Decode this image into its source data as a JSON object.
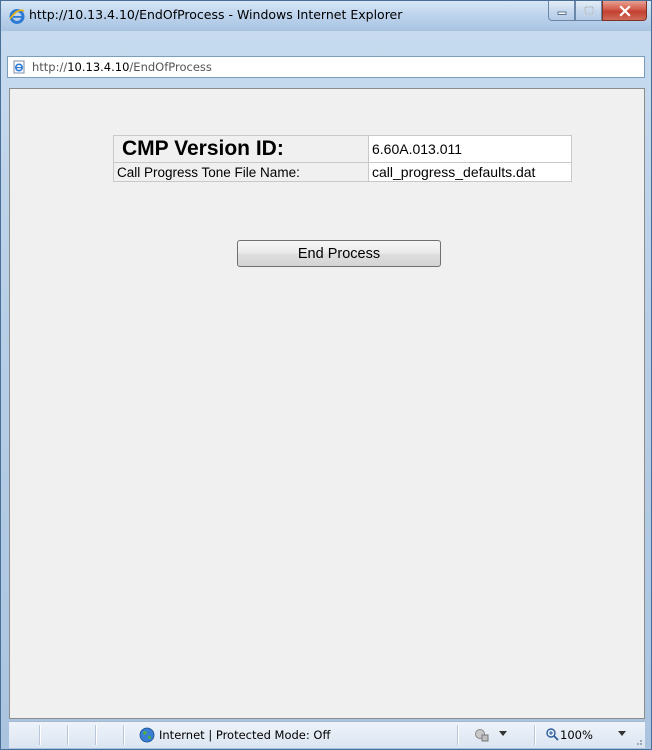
{
  "window": {
    "title": "http://10.13.4.10/EndOfProcess - Windows Internet Explorer"
  },
  "address_bar": {
    "url_prefix": "http://",
    "url_host": "10.13.4.10",
    "url_path": "/EndOfProcess"
  },
  "content": {
    "info_table": [
      {
        "label": "CMP Version ID:",
        "value": "6.60A.013.011"
      },
      {
        "label": "Call Progress Tone File Name:",
        "value": "call_progress_defaults.dat"
      }
    ],
    "end_process_label": "End Process"
  },
  "status_bar": {
    "zone": "Internet | Protected Mode: Off",
    "zoom": "100%"
  },
  "icons": {
    "browser": "ie-logo-icon",
    "page": "page-icon",
    "zone": "globe-icon",
    "protect": "protected-mode-icon",
    "zoom": "zoom-magnifier-icon"
  },
  "colors": {
    "chrome": "#b8cfe8",
    "close_button": "#c2402f",
    "content_bg": "#f0f0f0"
  }
}
